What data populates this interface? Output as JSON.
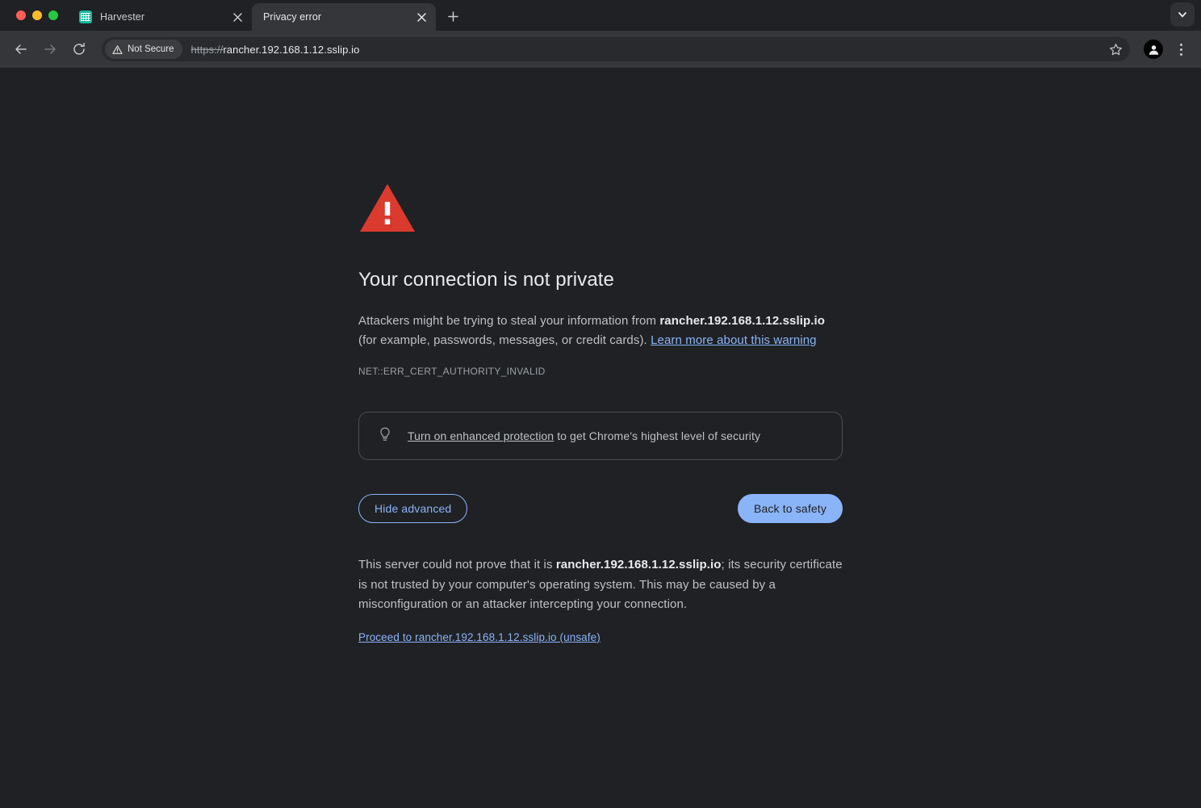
{
  "window": {
    "traffic_lights": [
      "close",
      "minimize",
      "maximize"
    ],
    "colors": {
      "red": "#ff5f57",
      "yellow": "#febc2e",
      "green": "#28c840",
      "page_background": "#202124",
      "toolbar_background": "#35363a",
      "omnibox_background": "#292a2d",
      "accent_blue": "#8ab4f8",
      "warning_red": "#db3a2f",
      "favicon_teal": "#17b79b"
    }
  },
  "tabstrip": {
    "tabs": [
      {
        "title": "Harvester",
        "favicon": "harvester-favicon",
        "active": false,
        "close_label": "Close"
      },
      {
        "title": "Privacy error",
        "favicon": "none",
        "active": true,
        "close_label": "Close"
      }
    ],
    "new_tab_label": "New Tab",
    "tab_search_label": "Search tabs"
  },
  "toolbar": {
    "back_label": "Back",
    "forward_label": "Forward",
    "reload_label": "Reload",
    "security_chip": {
      "icon": "warning-triangle-icon",
      "text": "Not Secure"
    },
    "url": {
      "scheme": "https://",
      "host": "rancher.192.168.1.12.sslip.io",
      "full": "https://rancher.192.168.1.12.sslip.io"
    },
    "bookmark_label": "Bookmark this tab",
    "profile_label": "Profile",
    "menu_label": "Customize and control Google Chrome"
  },
  "interstitial": {
    "icon": "warning-triangle-icon",
    "headline": "Your connection is not private",
    "body_prefix": "Attackers might be trying to steal your information from ",
    "body_host": "rancher.192.168.1.12.sslip.io",
    "body_middle": " (for example, passwords, messages, or credit cards). ",
    "learn_more_link": "Learn more about this warning",
    "error_code": "NET::ERR_CERT_AUTHORITY_INVALID",
    "enhanced_protection": {
      "icon": "lightbulb-icon",
      "link_text": "Turn on enhanced protection",
      "rest_text": " to get Chrome's highest level of security"
    },
    "buttons": {
      "advanced": "Hide advanced",
      "back_to_safety": "Back to safety"
    },
    "advanced": {
      "prefix": "This server could not prove that it is ",
      "host": "rancher.192.168.1.12.sslip.io",
      "suffix": "; its security certificate is not trusted by your computer's operating system. This may be caused by a misconfiguration or an attacker intercepting your connection.",
      "proceed_link": "Proceed to rancher.192.168.1.12.sslip.io (unsafe)"
    }
  }
}
